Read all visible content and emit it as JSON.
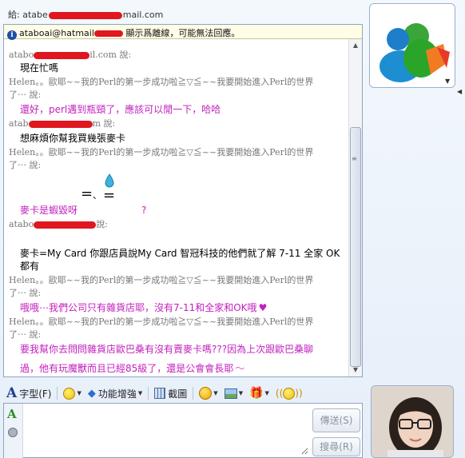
{
  "header": {
    "to_label": "給:",
    "to_prefix": "atabe",
    "to_suffix": "mail.com"
  },
  "notice": {
    "prefix": "ataboai@hatmail",
    "text": "顯示爲離線，可能無法回應。"
  },
  "messages": [
    {
      "kind": "said",
      "text": "atabo",
      "tail": "il.com 說:"
    },
    {
      "kind": "body",
      "text": "現在忙嗎"
    },
    {
      "kind": "said",
      "text": "Helen。。歐耶~~我的Perl的第一步成功啦≧▽≦~~我要開始進入Perl的世界"
    },
    {
      "kind": "said",
      "text": "了⋯ 說:"
    },
    {
      "kind": "pink",
      "text": "還好，perl遇到瓶頸了，應該可以閒一下，哈哈"
    },
    {
      "kind": "said",
      "text": "atab",
      "tail": "m 說:"
    },
    {
      "kind": "body",
      "text": "想麻煩你幫我買幾張麥卡"
    },
    {
      "kind": "said",
      "text": "Helen。。歐耶~~我的Perl的第一步成功啦≧▽≦~~我要開始進入Perl的世界"
    },
    {
      "kind": "said",
      "text": "了⋯ 說:"
    },
    {
      "kind": "pink",
      "text": "麥卡是蝦毀呀"
    },
    {
      "kind": "said",
      "text": "atabo",
      "tail": "說:"
    },
    {
      "kind": "body",
      "text": "麥卡=My Card 你跟店員說My Card  智冠科技的他們就了解 7-11 全家 OK"
    },
    {
      "kind": "body",
      "text": "都有"
    },
    {
      "kind": "said",
      "text": "Helen。。歐耶~~我的Perl的第一步成功啦≧▽≦~~我要開始進入Perl的世界"
    },
    {
      "kind": "said",
      "text": "了⋯ 說:"
    },
    {
      "kind": "pink",
      "text": "哦哦⋯我們公司只有雜貨店耶，沒有7-11和全家和OK哦"
    },
    {
      "kind": "said",
      "text": "Helen。。歐耶~~我的Perl的第一步成功啦≧▽≦~~我要開始進入Perl的世界"
    },
    {
      "kind": "said",
      "text": "了⋯ 說:"
    },
    {
      "kind": "pink",
      "text": "要我幫你去問問雜貨店歐巴桑有沒有賣麥卡嗎???因為上次跟歐巴桑聊"
    },
    {
      "kind": "pink",
      "text": "過，他有玩魔獸而且已經85級了，還是公會會長耶"
    }
  ],
  "emoticon": {
    "left": "=",
    "right": "=",
    "dot": "、",
    "q": "?"
  },
  "toolbar": {
    "font_label": "字型(F)",
    "feature_label": "功能增強",
    "screenshot_label": "截圖"
  },
  "compose": {
    "send_label": "傳送(S)",
    "search_label": "搜尋(R)"
  },
  "colors": {
    "pink_text": "#c21fbd",
    "redaction": "#e0171f"
  }
}
